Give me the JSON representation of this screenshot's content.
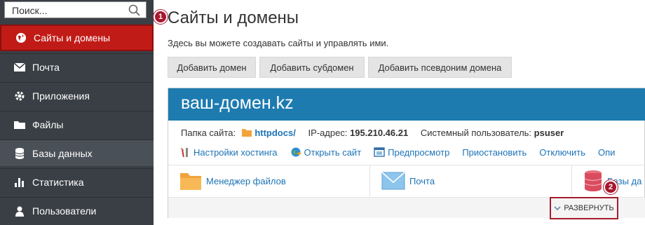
{
  "search": {
    "placeholder": "Поиск..."
  },
  "sidebar": {
    "items": [
      {
        "label": "Сайты и домены",
        "icon": "globe-icon",
        "active": true
      },
      {
        "label": "Почта",
        "icon": "envelope-icon"
      },
      {
        "label": "Приложения",
        "icon": "gear-icon"
      },
      {
        "label": "Файлы",
        "icon": "folder-icon"
      },
      {
        "label": "Базы данных",
        "icon": "database-icon"
      },
      {
        "label": "Статистика",
        "icon": "bar-chart-icon"
      },
      {
        "label": "Пользователи",
        "icon": "user-icon"
      }
    ]
  },
  "main": {
    "title": "Сайты и домены",
    "subtitle": "Здесь вы можете создавать сайты и управлять ими.",
    "buttons": [
      "Добавить домен",
      "Добавить субдомен",
      "Добавить псевдоним домена"
    ]
  },
  "domain": {
    "name": "ваш-домен.kz",
    "folder_label": "Папка сайта:",
    "folder_value": "httpdocs/",
    "ip_label": "IP-адрес:",
    "ip_value": "195.210.46.21",
    "user_label": "Системный пользователь:",
    "user_value": "psuser",
    "links": [
      "Настройки хостинга",
      "Открыть сайт",
      "Предпросмотр",
      "Приостановить",
      "Отключить",
      "Опи"
    ],
    "tiles": [
      "Менеджер файлов",
      "Почта",
      "Базы да"
    ],
    "expand_label": "РАЗВЕРНУТЬ"
  },
  "callouts": [
    "1",
    "2"
  ],
  "colors": {
    "accent": "#c11b17",
    "banner": "#1d7bb0",
    "link": "#1d74b6",
    "sidebar": "#3a3f45",
    "badge": "#a8172e"
  }
}
